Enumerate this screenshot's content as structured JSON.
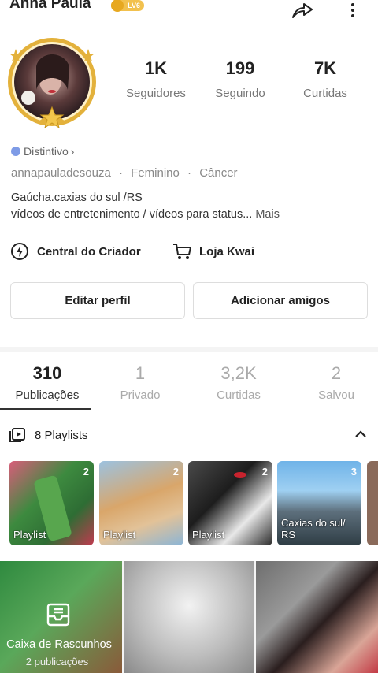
{
  "profile": {
    "name": "Anna Paula",
    "level": "LV6",
    "username": "annapauladesouza",
    "gender": "Feminino",
    "sign": "Câncer",
    "badge_label": "Distintivo",
    "bio_line1": "Gaúcha.caxias do sul /RS",
    "bio_line2": "vídeos de entretenimento / vídeos para status...",
    "bio_more": "Mais"
  },
  "stats": [
    {
      "value": "1K",
      "label": "Seguidores"
    },
    {
      "value": "199",
      "label": "Seguindo"
    },
    {
      "value": "7K",
      "label": "Curtidas"
    }
  ],
  "links": {
    "creator_center": "Central do Criador",
    "shop": "Loja Kwai"
  },
  "buttons": {
    "edit_profile": "Editar perfil",
    "add_friends": "Adicionar amigos"
  },
  "tabs": [
    {
      "count": "310",
      "label": "Publicações",
      "active": true
    },
    {
      "count": "1",
      "label": "Privado"
    },
    {
      "count": "3,2K",
      "label": "Curtidas"
    },
    {
      "count": "2",
      "label": "Salvou"
    }
  ],
  "playlists": {
    "header": "8 Playlists",
    "items": [
      {
        "count": "2",
        "caption": "Playlist"
      },
      {
        "count": "2",
        "caption": "Playlist"
      },
      {
        "count": "2",
        "caption": "Playlist"
      },
      {
        "count": "3",
        "caption": "Caxias do sul/ RS"
      }
    ]
  },
  "drafts": {
    "title": "Caixa de Rascunhos",
    "subtitle": "2 publicações"
  },
  "icons": {
    "share": "share-icon",
    "more": "more-vertical-icon",
    "badge": "badge-icon",
    "creator": "lightning-icon",
    "cart": "cart-icon",
    "playlist": "playlist-icon",
    "collapse": "chevron-up-icon",
    "drafts": "drafts-icon"
  },
  "colors": {
    "level_badge": "#f2c14e",
    "avatar_ring": "#e3b13b"
  }
}
